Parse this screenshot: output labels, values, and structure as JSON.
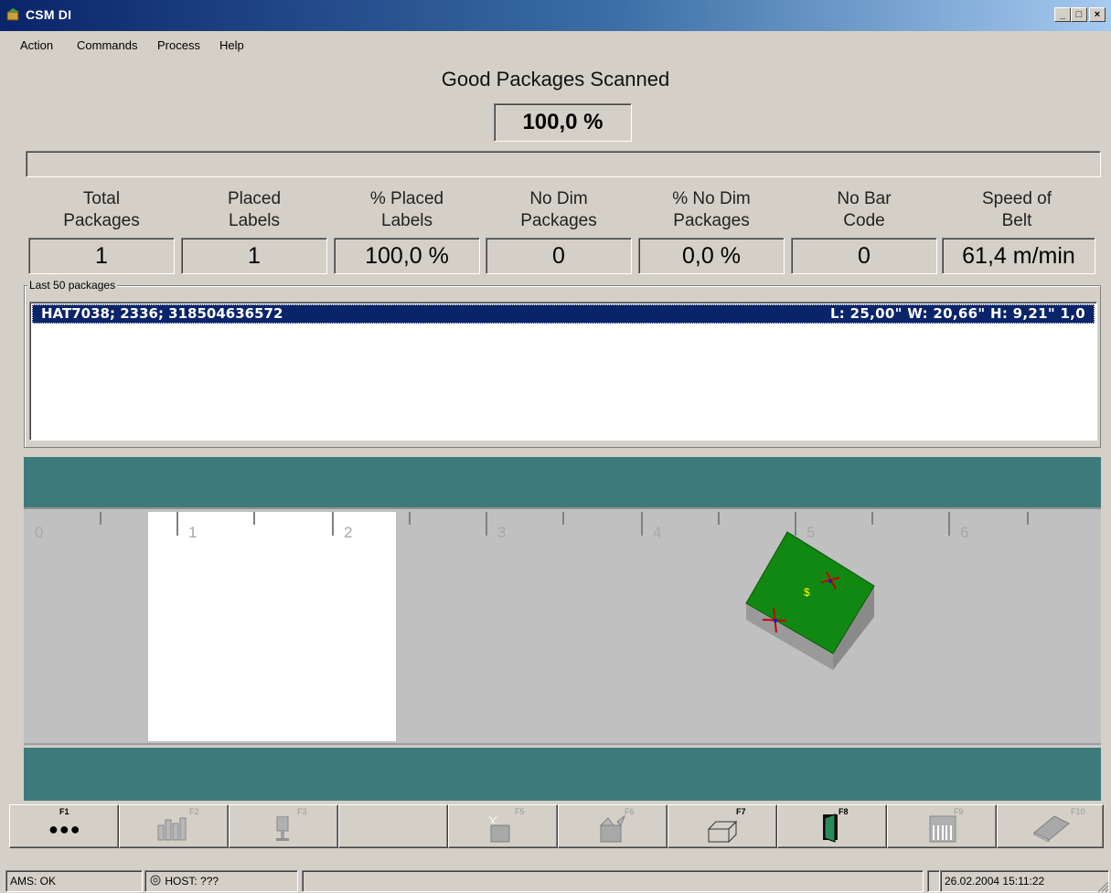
{
  "window": {
    "title": "CSM DI"
  },
  "menu": [
    "Action",
    "Commands",
    "Process",
    "Help"
  ],
  "header": {
    "title": "Good Packages Scanned",
    "value": "100,0 %"
  },
  "stats": [
    {
      "label_line1": "Total",
      "label_line2": "Packages",
      "value": "1"
    },
    {
      "label_line1": "Placed",
      "label_line2": "Labels",
      "value": "1"
    },
    {
      "label_line1": "% Placed",
      "label_line2": "Labels",
      "value": "100,0 %"
    },
    {
      "label_line1": "No Dim",
      "label_line2": "Packages",
      "value": "0"
    },
    {
      "label_line1": "% No Dim",
      "label_line2": "Packages",
      "value": "0,0 %"
    },
    {
      "label_line1": "No Bar",
      "label_line2": "Code",
      "value": "0"
    },
    {
      "label_line1": "Speed of",
      "label_line2": "Belt",
      "value": "61,4 m/min"
    }
  ],
  "packages": {
    "group_label": "Last 50 packages",
    "rows": [
      {
        "id_text": "HAT7038; 2336; 318504636572",
        "dims_text": "L: 25,00\"  W: 20,66\"  H:  9,21\"      1,0"
      }
    ]
  },
  "belt": {
    "ruler_labels": [
      "0",
      "1",
      "2",
      "3",
      "4",
      "5",
      "6"
    ],
    "rail_color": "#3d7b7b",
    "belt_color": "#c0c0c0",
    "package_color": "#118811",
    "package_symbol": "$"
  },
  "toolbar": {
    "buttons": [
      {
        "key": "F1",
        "icon": "dots-icon"
      },
      {
        "key": "F2",
        "icon": "chart-icon"
      },
      {
        "key": "F3",
        "icon": "scanner-icon"
      },
      {
        "key": "",
        "icon": ""
      },
      {
        "key": "F5",
        "icon": "box-scan-icon"
      },
      {
        "key": "F6",
        "icon": "box-open-icon"
      },
      {
        "key": "F7",
        "icon": "box-outline-icon"
      },
      {
        "key": "F8",
        "icon": "exit-door-icon"
      },
      {
        "key": "F9",
        "icon": "barcode-icon"
      },
      {
        "key": "F10",
        "icon": "book-icon"
      }
    ]
  },
  "status": {
    "ams": "AMS: OK",
    "host": "HOST: ???",
    "datetime": "26.02.2004 15:11:22"
  }
}
